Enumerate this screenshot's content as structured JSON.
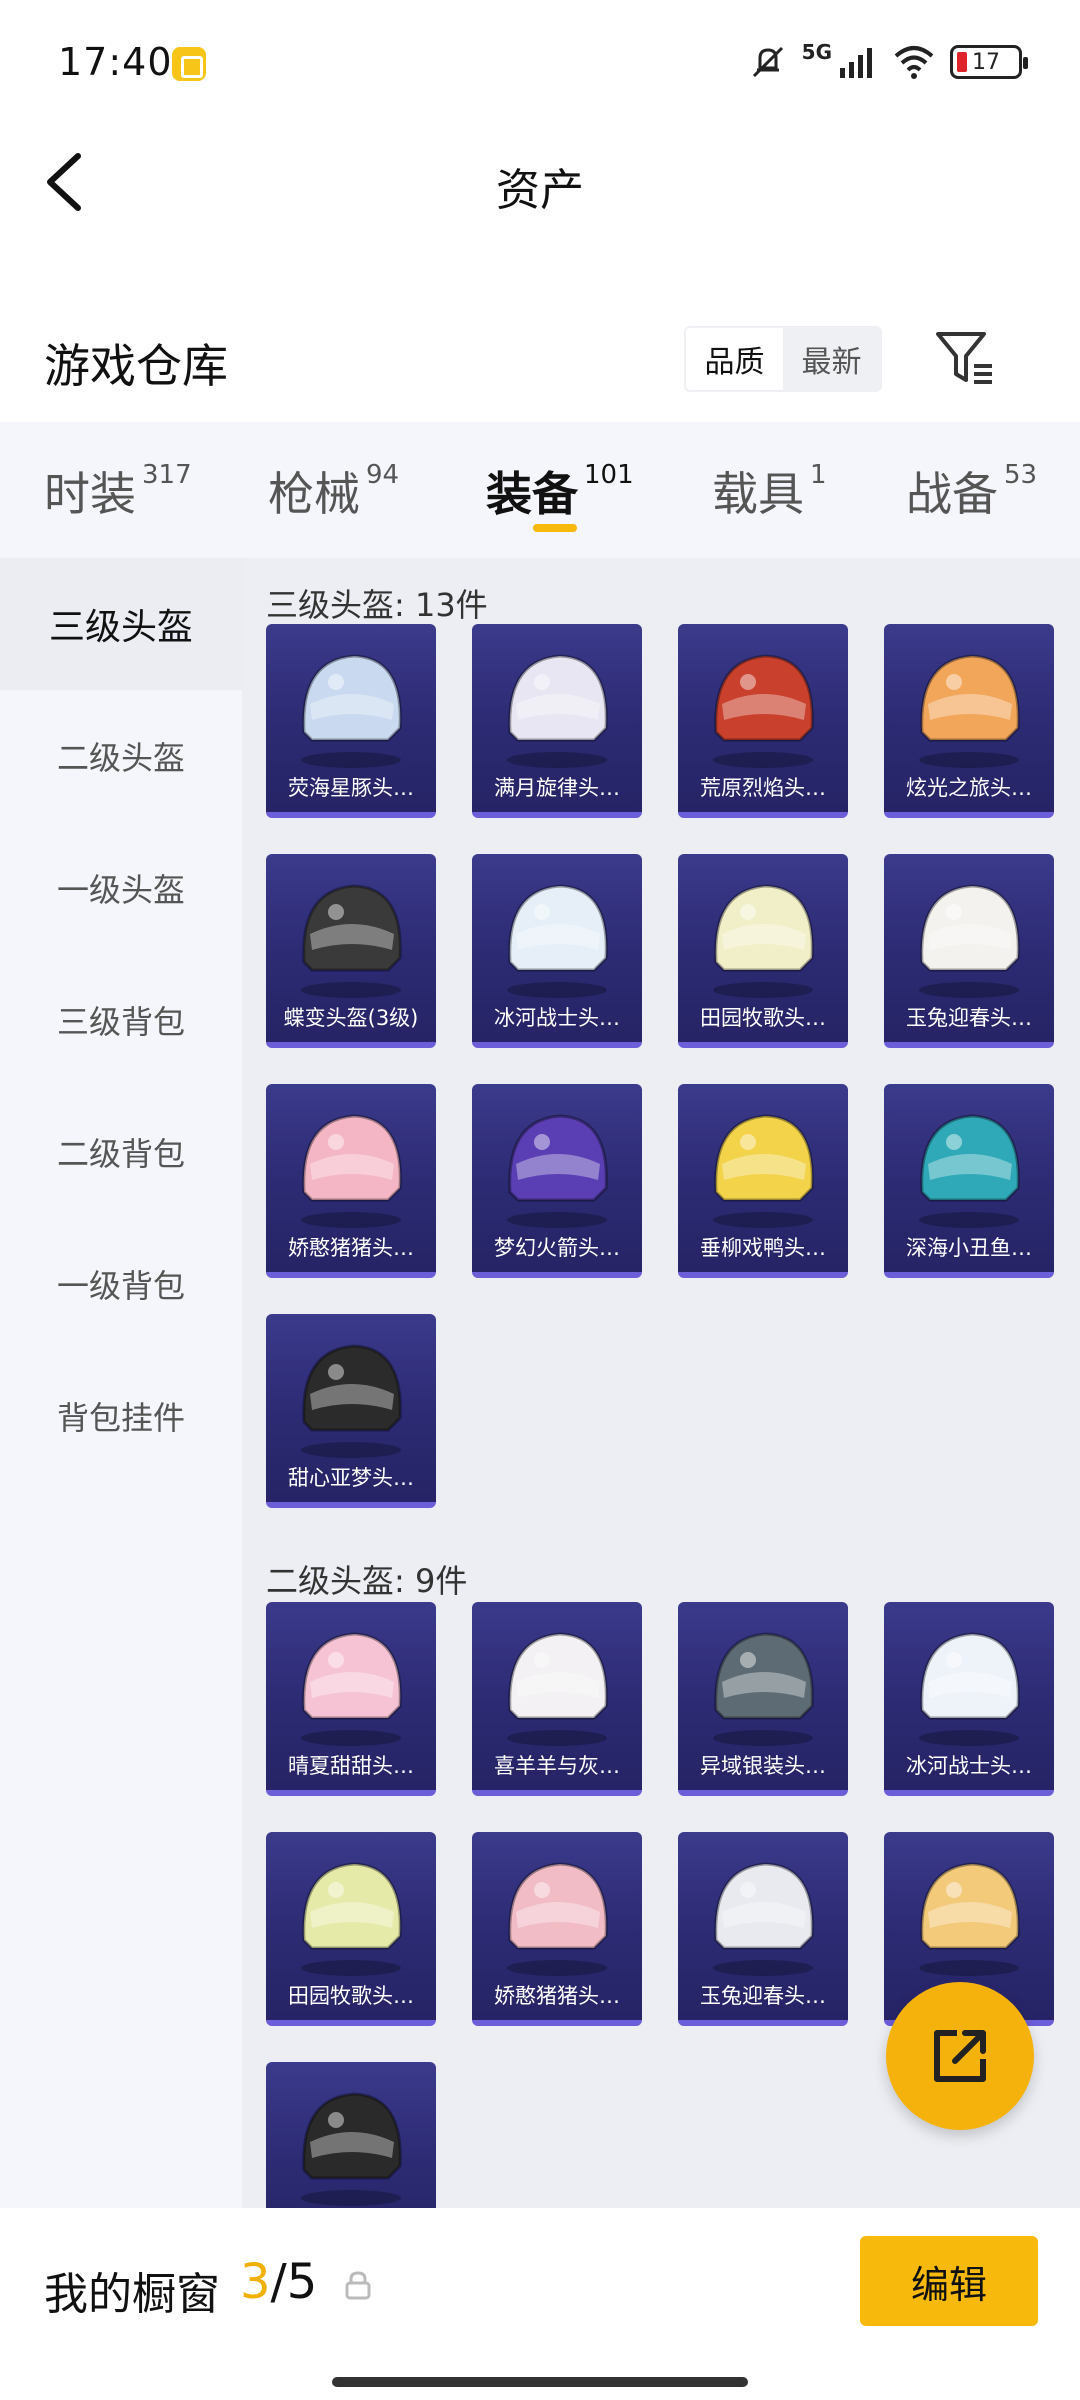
{
  "status_bar": {
    "time": "17:40",
    "network": "5G",
    "battery": "17"
  },
  "header": {
    "title": "资产"
  },
  "warehouse": {
    "title": "游戏仓库",
    "sort_options": [
      "品质",
      "最新"
    ]
  },
  "tabs": [
    {
      "label": "时装",
      "count": "317"
    },
    {
      "label": "枪械",
      "count": "94"
    },
    {
      "label": "装备",
      "count": "101"
    },
    {
      "label": "载具",
      "count": "1"
    },
    {
      "label": "战备",
      "count": "53"
    }
  ],
  "sidebar": {
    "items": [
      "三级头盔",
      "二级头盔",
      "一级头盔",
      "三级背包",
      "二级背包",
      "一级背包",
      "背包挂件"
    ]
  },
  "sections": [
    {
      "title": "三级头盔: 13件",
      "items": [
        "荧海星豚头…",
        "满月旋律头…",
        "荒原烈焰头…",
        "炫光之旅头…",
        "蝶变头盔(3级)",
        "冰河战士头…",
        "田园牧歌头…",
        "玉兔迎春头…",
        "娇憨猪猪头…",
        "梦幻火箭头…",
        "垂柳戏鸭头…",
        "深海小丑鱼…",
        "甜心亚梦头…"
      ]
    },
    {
      "title": "二级头盔: 9件",
      "items": [
        "晴夏甜甜头…",
        "喜羊羊与灰…",
        "异域银装头…",
        "冰河战士头…",
        "田园牧歌头…",
        "娇憨猪猪头…",
        "玉兔迎春头…",
        "",
        ""
      ]
    }
  ],
  "item_colors": {
    "s1": [
      "#c8d9f0",
      "#e8e6f2",
      "#c9402c",
      "#f2a65a",
      "#3a3a3a",
      "#e6eef8",
      "#f1efc8",
      "#f4f2ef",
      "#f4b5c4",
      "#5a3fb4",
      "#f2d34a",
      "#2fa9b8",
      "#2b2b2b"
    ],
    "s2": [
      "#f6c3d4",
      "#f3f1f3",
      "#5d6c74",
      "#eef3fa",
      "#e6eaa8",
      "#f1bcc6",
      "#e8eaf0",
      "#f3c97a",
      "#2a2a2a"
    ]
  },
  "bottom": {
    "showcase_label": "我的橱窗",
    "showcase_current": "3",
    "showcase_total": "/5",
    "edit_label": "编辑"
  }
}
